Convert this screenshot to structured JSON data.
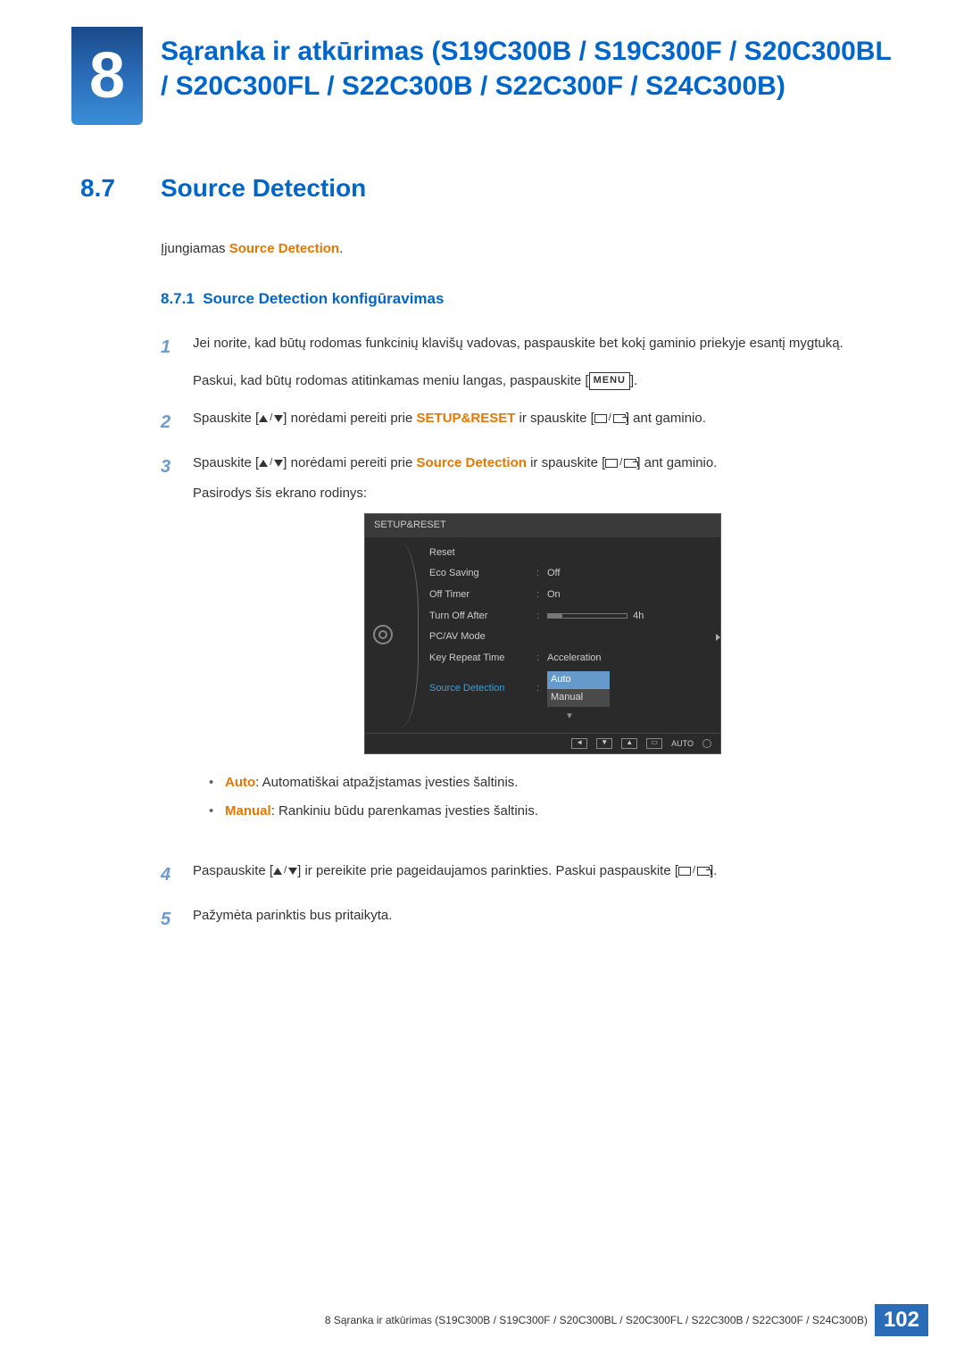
{
  "chapter": {
    "number": "8",
    "title": "Sąranka ir atkūrimas (S19C300B / S19C300F / S20C300BL / S20C300FL / S22C300B / S22C300F / S24C300B)"
  },
  "section": {
    "number": "8.7",
    "title": "Source Detection"
  },
  "intro": {
    "prefix": "Įjungiamas ",
    "term": "Source Detection",
    "suffix": "."
  },
  "subsection": {
    "number": "8.7.1",
    "title": "Source Detection konfigūravimas"
  },
  "steps": {
    "s1a": "Jei norite, kad būtų rodomas funkcinių klavišų vadovas, paspauskite bet kokį gaminio priekyje esantį mygtuką.",
    "s1b_pre": "Paskui, kad būtų rodomas atitinkamas meniu langas, paspauskite [",
    "s1b_menu": "MENU",
    "s1b_post": "].",
    "s2_pre": "Spauskite [",
    "s2_mid": "] norėdami pereiti prie ",
    "s2_term": "SETUP&RESET",
    "s2_mid2": " ir spauskite [",
    "s2_post": "] ant gaminio.",
    "s3_pre": "Spauskite [",
    "s3_mid": "] norėdami pereiti prie ",
    "s3_term": "Source Detection",
    "s3_mid2": " ir spauskite [",
    "s3_post": "] ant gaminio.",
    "s3b": "Pasirodys šis ekrano rodinys:",
    "s4_pre": "Paspauskite [",
    "s4_mid": "] ir pereikite prie pageidaujamos parinkties. Paskui paspauskite [",
    "s4_post": "].",
    "s5": "Pažymėta parinktis bus pritaikyta."
  },
  "osd": {
    "title": "SETUP&RESET",
    "items": [
      {
        "label": "Reset",
        "value": ""
      },
      {
        "label": "Eco Saving",
        "value": "Off"
      },
      {
        "label": "Off Timer",
        "value": "On"
      },
      {
        "label": "Turn Off After",
        "value": "4h",
        "slider": true
      },
      {
        "label": "PC/AV Mode",
        "value": "",
        "arrow": true
      },
      {
        "label": "Key Repeat Time",
        "value": "Acceleration"
      },
      {
        "label": "Source Detection",
        "value": "",
        "active": true,
        "dropdown": [
          "Auto",
          "Manual"
        ]
      }
    ],
    "bottom_auto": "AUTO"
  },
  "bullets": {
    "auto_label": "Auto",
    "auto_text": ": Automatiškai atpažįstamas įvesties šaltinis.",
    "manual_label": "Manual",
    "manual_text": ": Rankiniu būdu parenkamas įvesties šaltinis."
  },
  "footer": {
    "text": "8 Sąranka ir atkūrimas (S19C300B / S19C300F / S20C300BL / S20C300FL / S22C300B / S22C300F / S24C300B)",
    "page": "102"
  }
}
